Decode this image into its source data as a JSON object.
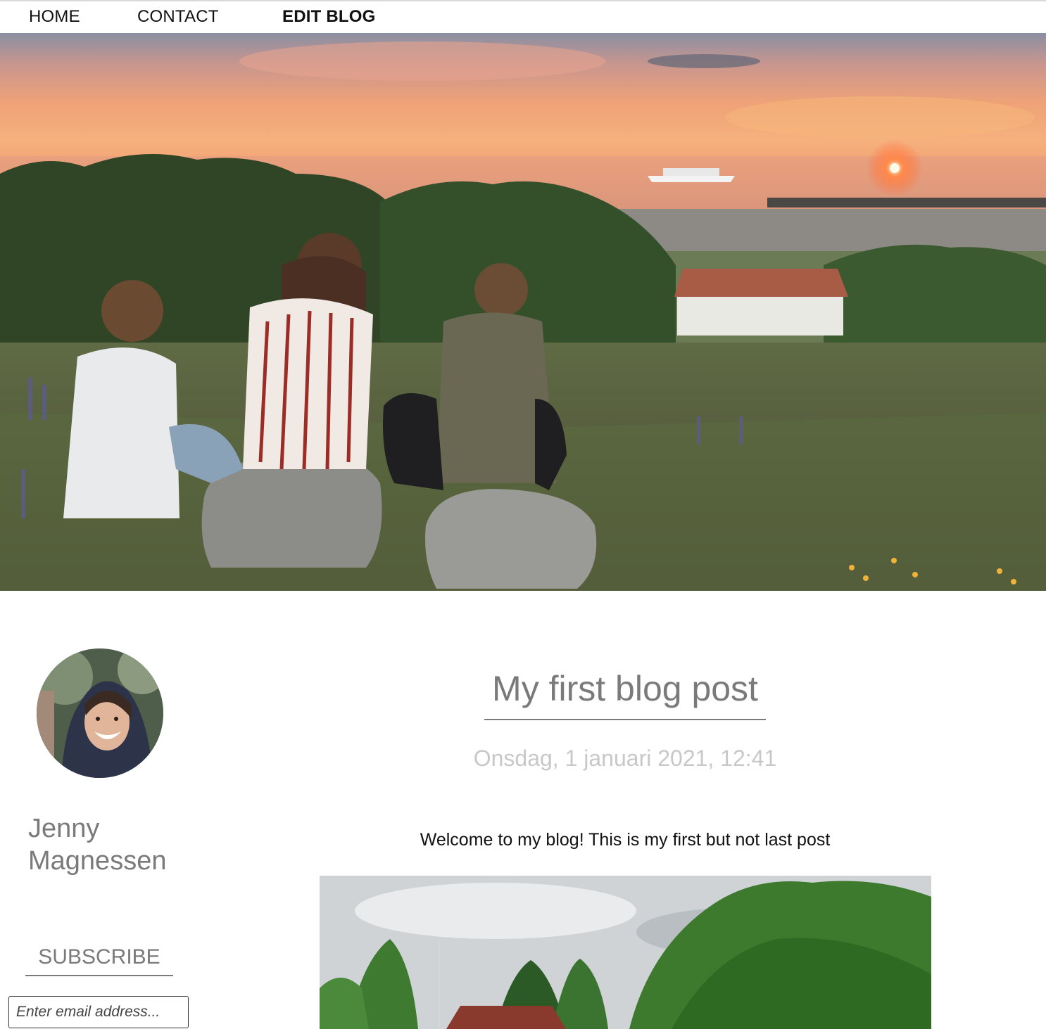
{
  "nav": {
    "home": "HOME",
    "contact": "CONTACT",
    "edit_blog": "EDIT BLOG"
  },
  "sidebar": {
    "author_first": "Jenny",
    "author_last": "Magnessen",
    "subscribe_label": "SUBSCRIBE",
    "email_placeholder": "Enter email address..."
  },
  "post": {
    "title": "My first blog post",
    "date": "Onsdag, 1 januari 2021, 12:41",
    "body": "Welcome to my blog! This is my first but not last post"
  }
}
